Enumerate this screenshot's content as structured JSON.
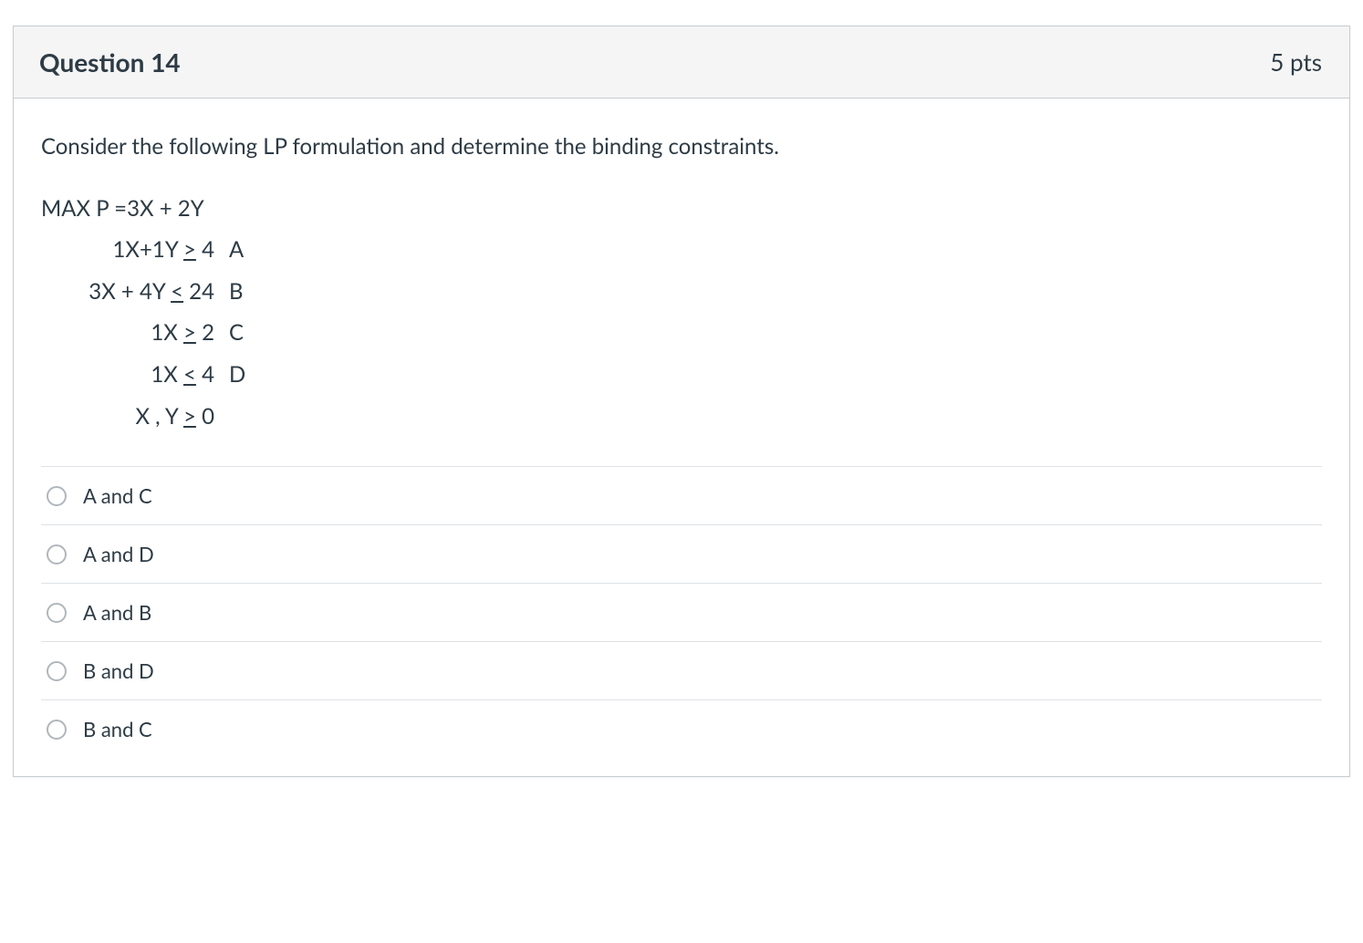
{
  "header": {
    "title": "Question 14",
    "points": "5 pts"
  },
  "prompt": "Consider the following LP formulation and determine the binding constraints.",
  "formulation": {
    "objective": "MAX P =3X + 2Y",
    "rows": [
      {
        "left_a": "1X+1Y ",
        "op": ">",
        "left_b": " 4",
        "label": "A"
      },
      {
        "left_a": "3X + 4Y ",
        "op": "<",
        "left_b": " 24",
        "label": "B"
      },
      {
        "left_a": "1X ",
        "op": ">",
        "left_b": " 2",
        "label": "C"
      },
      {
        "left_a": "1X ",
        "op": "<",
        "left_b": " 4",
        "label": "D"
      },
      {
        "left_a": "X , Y ",
        "op": ">",
        "left_b": " 0",
        "label": ""
      }
    ]
  },
  "answers": [
    "A and C",
    "A and D",
    "A and B",
    "B and D",
    "B and C"
  ]
}
